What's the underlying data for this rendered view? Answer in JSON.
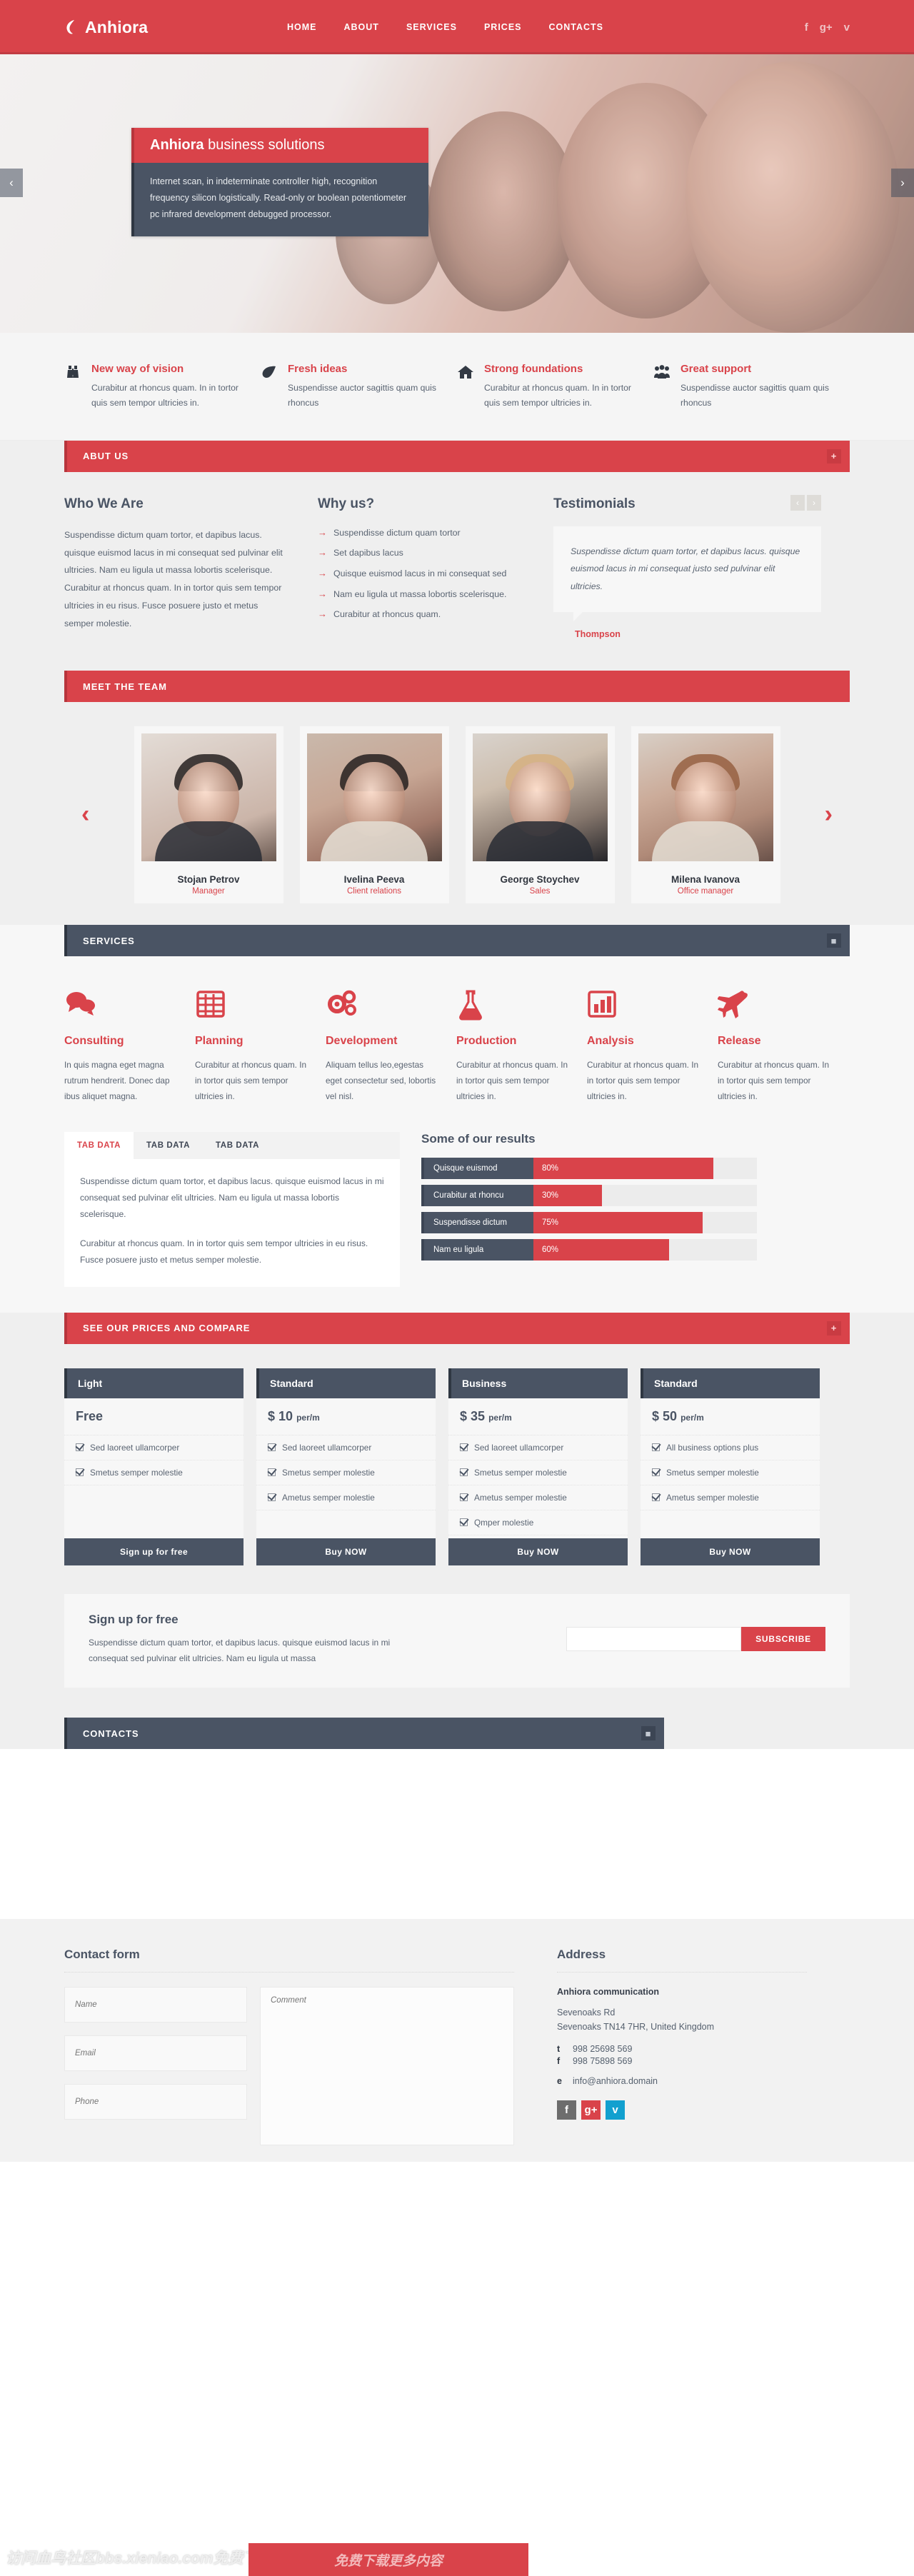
{
  "header": {
    "brand": "Anhiora",
    "logo_icon": "leaf-icon",
    "nav": [
      {
        "label": "HOME"
      },
      {
        "label": "ABOUT"
      },
      {
        "label": "SERVICES"
      },
      {
        "label": "PRICES"
      },
      {
        "label": "CONTACTS"
      }
    ],
    "social": [
      {
        "name": "facebook-icon",
        "glyph": "f"
      },
      {
        "name": "google-plus-icon",
        "glyph": "g+"
      },
      {
        "name": "twitter-icon",
        "glyph": "ᴠ"
      }
    ]
  },
  "hero": {
    "title_bold": "Anhiora",
    "title_rest": " business solutions",
    "body": "Internet scan, in indeterminate controller high, recognition frequency silicon logistically. Read-only or boolean potentiometer pc infrared development debugged processor.",
    "prev": "‹",
    "next": "›"
  },
  "features": [
    {
      "icon": "binoculars-icon",
      "title": "New way of vision",
      "text": "Curabitur at rhoncus quam. In in tortor quis sem tempor ultricies in."
    },
    {
      "icon": "leaf-icon",
      "title": "Fresh ideas",
      "text": "Suspendisse auctor sagittis quam quis rhoncus"
    },
    {
      "icon": "home-icon",
      "title": "Strong foundations",
      "text": "Curabitur at rhoncus quam. In in tortor quis sem tempor ultricies in."
    },
    {
      "icon": "group-icon",
      "title": "Great support",
      "text": "Suspendisse auctor sagittis quam quis rhoncus"
    }
  ],
  "about": {
    "bar_title": "ABUT US",
    "bar_button": "+",
    "who_heading": "Who We Are",
    "who_text": "Suspendisse dictum quam tortor, et dapibus lacus. quisque euismod lacus in mi consequat sed pulvinar elit ultricies. Nam eu ligula ut massa lobortis scelerisque. Curabitur at rhoncus quam. In in tortor quis sem tempor ultricies in eu risus. Fusce posuere justo et metus semper molestie.",
    "why_heading": "Why us?",
    "why_items": [
      "Suspendisse dictum quam tortor",
      "Set dapibus lacus",
      "Quisque euismod lacus in mi consequat sed",
      "Nam eu ligula ut massa lobortis scelerisque.",
      "Curabitur at rhoncus quam."
    ],
    "testimonials_heading": "Testimonials",
    "testimonial_prev": "‹",
    "testimonial_next": "›",
    "testimonial_text": "Suspendisse dictum quam tortor, et dapibus lacus. quisque euismod lacus in mi consequat justo sed pulvinar elit ultricies.",
    "testimonial_author": "Thompson"
  },
  "team": {
    "bar_title": "MEET THE TEAM",
    "prev": "‹",
    "next": "›",
    "members": [
      {
        "name": "Stojan Petrov",
        "role": "Manager"
      },
      {
        "name": "Ivelina Peeva",
        "role": "Client relations"
      },
      {
        "name": "George Stoychev",
        "role": "Sales"
      },
      {
        "name": "Milena Ivanova",
        "role": "Office manager"
      }
    ]
  },
  "services": {
    "bar_title": "SERVICES",
    "bar_button": "■",
    "items": [
      {
        "icon": "chat-bubbles-icon",
        "title": "Consulting",
        "text": "In quis magna eget magna rutrum hendrerit. Donec dap ibus aliquet magna."
      },
      {
        "icon": "calendar-grid-icon",
        "title": "Planning",
        "text": "Curabitur at rhoncus quam. In in tortor quis sem tempor ultricies in."
      },
      {
        "icon": "gears-icon",
        "title": "Development",
        "text": "Aliquam tellus leo,egestas eget consectetur sed, lobortis vel nisl."
      },
      {
        "icon": "flask-icon",
        "title": "Production",
        "text": "Curabitur at rhoncus quam. In in tortor quis sem tempor ultricies in."
      },
      {
        "icon": "bar-chart-icon",
        "title": "Analysis",
        "text": "Curabitur at rhoncus quam. In in tortor quis sem tempor ultricies in."
      },
      {
        "icon": "airplane-icon",
        "title": "Release",
        "text": "Curabitur at rhoncus quam. In in tortor quis sem tempor ultricies in."
      }
    ],
    "tabs": [
      {
        "label": "TAB DATA",
        "active": true
      },
      {
        "label": "TAB DATA",
        "active": false
      },
      {
        "label": "TAB DATA",
        "active": false
      }
    ],
    "tab_paragraph_1": "Suspendisse dictum quam tortor, et dapibus lacus. quisque euismod lacus in mi consequat sed pulvinar elit ultricies. Nam eu ligula ut massa lobortis scelerisque.",
    "tab_paragraph_2": "Curabitur at rhoncus quam. In in tortor quis sem tempor ultricies in eu risus. Fusce posuere justo et metus semper molestie."
  },
  "chart_data": {
    "type": "bar",
    "title": "Some of our results",
    "categories": [
      "Quisque euismod",
      "Curabitur at rhoncu",
      "Suspendisse dictum",
      "Nam eu ligula"
    ],
    "values": [
      80,
      30,
      75,
      60
    ],
    "value_labels": [
      "80%",
      "30%",
      "75%",
      "60%"
    ],
    "xlabel": "",
    "ylabel": "",
    "xlim": [
      0,
      100
    ],
    "grid": false,
    "legend": "none",
    "orientation": "horizontal",
    "bar_color": "#d9434a",
    "track_color": "#ececec",
    "label_bg": "#4a5464"
  },
  "pricing": {
    "bar_title": "SEE OUR PRICES AND COMPARE",
    "bar_button": "+",
    "plans": [
      {
        "name": "Light",
        "price": "Free",
        "period": "",
        "features": [
          "Sed laoreet ullamcorper",
          "Smetus semper molestie"
        ],
        "cta": "Sign up for free"
      },
      {
        "name": "Standard",
        "price": "$ 10",
        "period": "per/m",
        "features": [
          "Sed laoreet ullamcorper",
          "Smetus semper molestie",
          "Ametus semper molestie"
        ],
        "cta": "Buy NOW"
      },
      {
        "name": "Business",
        "price": "$ 35",
        "period": "per/m",
        "features": [
          "Sed laoreet ullamcorper",
          "Smetus semper molestie",
          "Ametus semper molestie",
          "Qmper molestie"
        ],
        "cta": "Buy NOW"
      },
      {
        "name": "Standard",
        "price": "$ 50",
        "period": "per/m",
        "features": [
          "All business options plus",
          "Smetus semper molestie",
          "Ametus semper molestie"
        ],
        "cta": "Buy NOW"
      }
    ]
  },
  "signup": {
    "heading": "Sign up for free",
    "text": "Suspendisse dictum quam tortor, et dapibus lacus. quisque euismod lacus in mi consequat sed pulvinar elit ultricies. Nam eu ligula ut massa",
    "input_value": "",
    "input_placeholder": "",
    "button": "SUBSCRIBE"
  },
  "contacts": {
    "bar_title": "CONTACTS",
    "bar_button": "■"
  },
  "footer": {
    "form_heading": "Contact form",
    "name_placeholder": "Name",
    "email_placeholder": "Email",
    "phone_placeholder": "Phone",
    "comment_placeholder": "Comment",
    "address_heading": "Address",
    "company": "Anhiora communication",
    "street": "Sevenoaks Rd",
    "city": "Sevenoaks TN14 7HR, United Kingdom",
    "tel_key": "t",
    "tel": "998 25698 569",
    "fax_key": "f",
    "fax": "998 75898 569",
    "email_key": "e",
    "email": "info@anhiora.domain",
    "social": [
      {
        "name": "facebook-icon",
        "glyph": "f"
      },
      {
        "name": "google-plus-icon",
        "glyph": "g+"
      },
      {
        "name": "twitter-icon",
        "glyph": "ᴠ"
      }
    ]
  },
  "watermark": {
    "left_text": "访问血鸟社区bbs.xieniao.com免费下载",
    "bar_text": "免费下载更多内容"
  }
}
